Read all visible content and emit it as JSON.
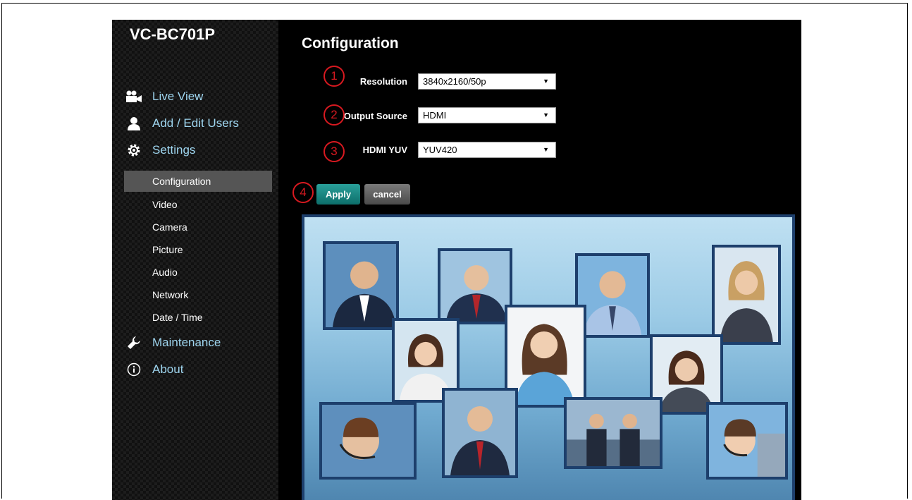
{
  "sidebar": {
    "brand": "VC-BC701P",
    "main_items": [
      {
        "label": "Live View",
        "icon": "video-camera-icon"
      },
      {
        "label": "Add / Edit Users",
        "icon": "user-icon"
      },
      {
        "label": "Settings",
        "icon": "gear-icon"
      },
      {
        "label": "Maintenance",
        "icon": "wrench-icon"
      },
      {
        "label": "About",
        "icon": "info-icon"
      }
    ],
    "sub_items": [
      {
        "label": "Configuration",
        "active": true
      },
      {
        "label": "Video"
      },
      {
        "label": "Camera"
      },
      {
        "label": "Picture"
      },
      {
        "label": "Audio"
      },
      {
        "label": "Network"
      },
      {
        "label": "Date / Time"
      }
    ]
  },
  "main": {
    "title": "Configuration",
    "fields": [
      {
        "marker": "1",
        "label": "Resolution",
        "value": "3840x2160/50p"
      },
      {
        "marker": "2",
        "label": "Output Source",
        "value": "HDMI"
      },
      {
        "marker": "3",
        "label": "HDMI YUV",
        "value": "YUV420"
      }
    ],
    "apply_marker": "4",
    "apply_label": "Apply",
    "cancel_label": "cancel"
  },
  "colors": {
    "accent": "#9fd6f0",
    "marker": "#d71920",
    "apply": "#1a8a85",
    "frame": "#1d3f6c"
  }
}
